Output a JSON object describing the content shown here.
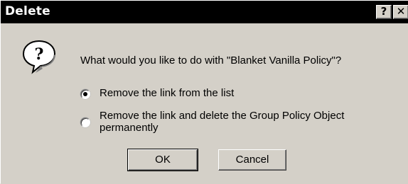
{
  "dialog": {
    "title": "Delete",
    "help_button": "?",
    "close_button": "✕",
    "message": "What would you like to do with \"Blanket Vanilla Policy\"?",
    "icon": "question-icon",
    "options": [
      {
        "label": "Remove the link from the list",
        "selected": true
      },
      {
        "label": "Remove the link and delete the Group Policy Object permanently",
        "selected": false
      }
    ],
    "ok_label": "OK",
    "cancel_label": "Cancel"
  }
}
